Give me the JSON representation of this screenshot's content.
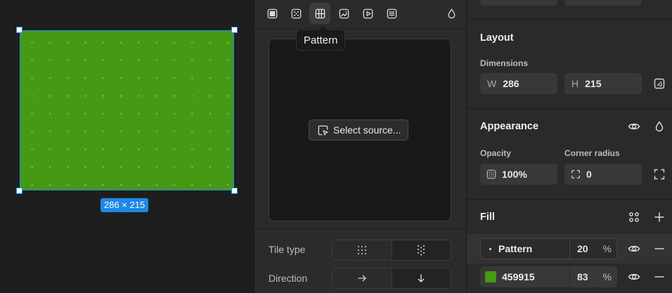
{
  "canvas": {
    "selection_size_label": "286 × 215",
    "fill_color": "#459915",
    "selection_color": "#1e8bf0"
  },
  "fill_popover": {
    "fill_types": [
      {
        "name": "solid",
        "icon": "solid-fill-icon"
      },
      {
        "name": "gradient",
        "icon": "gradient-dots-icon"
      },
      {
        "name": "pattern",
        "icon": "pattern-icon",
        "active": true
      },
      {
        "name": "image",
        "icon": "image-icon"
      },
      {
        "name": "video",
        "icon": "video-icon"
      },
      {
        "name": "noise",
        "icon": "noise-icon"
      }
    ],
    "blend_icon": "droplet-icon",
    "tooltip": "Pattern",
    "select_source_label": "Select source...",
    "tile_type_label": "Tile type",
    "direction_label": "Direction",
    "tile_type_options": [
      "grid-dots-icon",
      "offset-dots-icon"
    ],
    "tile_type_selected": 1,
    "direction_options": [
      "arrow-right-icon",
      "arrow-down-icon"
    ],
    "direction_selected": 1
  },
  "inspector": {
    "layout": {
      "title": "Layout",
      "dimensions_label": "Dimensions",
      "width_prefix": "W",
      "width_value": "286",
      "height_prefix": "H",
      "height_value": "215"
    },
    "appearance": {
      "title": "Appearance",
      "opacity_label": "Opacity",
      "opacity_value": "100%",
      "corner_radius_label": "Corner radius",
      "corner_radius_value": "0"
    },
    "fill": {
      "title": "Fill",
      "items": [
        {
          "name": "Pattern",
          "opacity": "20",
          "unit": "%",
          "highlighted": true
        },
        {
          "name": "459915",
          "opacity": "83",
          "unit": "%",
          "color": "#459915"
        }
      ]
    }
  }
}
